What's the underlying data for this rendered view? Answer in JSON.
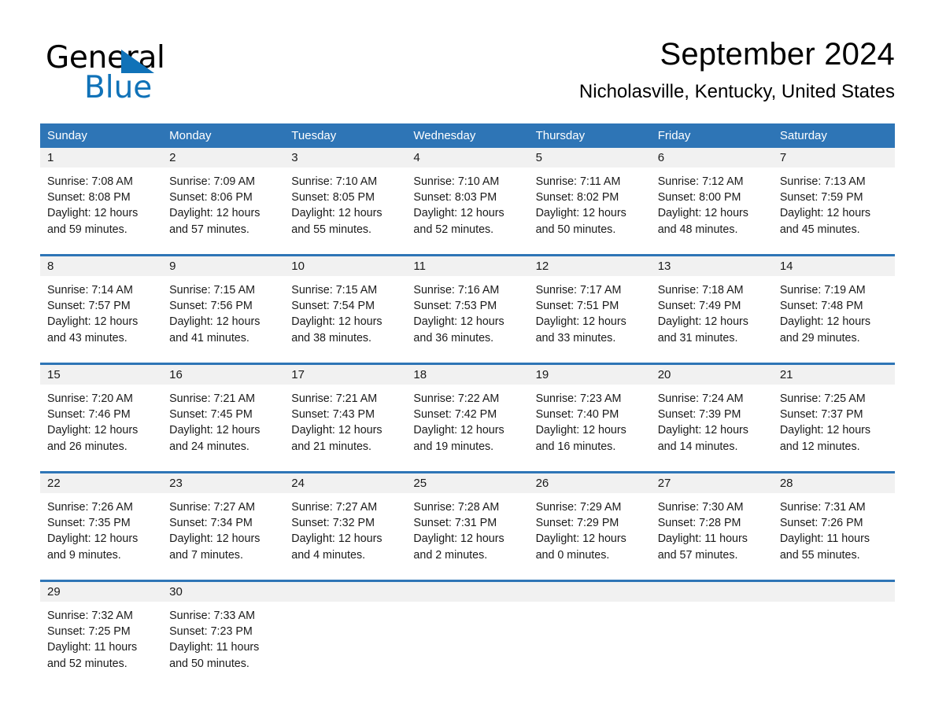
{
  "brand": {
    "logo_text_primary": "General",
    "logo_text_secondary": "Blue",
    "accent_color": "#2e75b6",
    "logo_blue": "#1072b8"
  },
  "header": {
    "title": "September 2024",
    "location": "Nicholasville, Kentucky, United States"
  },
  "calendar": {
    "weekdays": [
      "Sunday",
      "Monday",
      "Tuesday",
      "Wednesday",
      "Thursday",
      "Friday",
      "Saturday"
    ],
    "weeks": [
      {
        "days": [
          {
            "date": "1",
            "sunrise": "Sunrise: 7:08 AM",
            "sunset": "Sunset: 8:08 PM",
            "daylight": "Daylight: 12 hours and 59 minutes."
          },
          {
            "date": "2",
            "sunrise": "Sunrise: 7:09 AM",
            "sunset": "Sunset: 8:06 PM",
            "daylight": "Daylight: 12 hours and 57 minutes."
          },
          {
            "date": "3",
            "sunrise": "Sunrise: 7:10 AM",
            "sunset": "Sunset: 8:05 PM",
            "daylight": "Daylight: 12 hours and 55 minutes."
          },
          {
            "date": "4",
            "sunrise": "Sunrise: 7:10 AM",
            "sunset": "Sunset: 8:03 PM",
            "daylight": "Daylight: 12 hours and 52 minutes."
          },
          {
            "date": "5",
            "sunrise": "Sunrise: 7:11 AM",
            "sunset": "Sunset: 8:02 PM",
            "daylight": "Daylight: 12 hours and 50 minutes."
          },
          {
            "date": "6",
            "sunrise": "Sunrise: 7:12 AM",
            "sunset": "Sunset: 8:00 PM",
            "daylight": "Daylight: 12 hours and 48 minutes."
          },
          {
            "date": "7",
            "sunrise": "Sunrise: 7:13 AM",
            "sunset": "Sunset: 7:59 PM",
            "daylight": "Daylight: 12 hours and 45 minutes."
          }
        ]
      },
      {
        "days": [
          {
            "date": "8",
            "sunrise": "Sunrise: 7:14 AM",
            "sunset": "Sunset: 7:57 PM",
            "daylight": "Daylight: 12 hours and 43 minutes."
          },
          {
            "date": "9",
            "sunrise": "Sunrise: 7:15 AM",
            "sunset": "Sunset: 7:56 PM",
            "daylight": "Daylight: 12 hours and 41 minutes."
          },
          {
            "date": "10",
            "sunrise": "Sunrise: 7:15 AM",
            "sunset": "Sunset: 7:54 PM",
            "daylight": "Daylight: 12 hours and 38 minutes."
          },
          {
            "date": "11",
            "sunrise": "Sunrise: 7:16 AM",
            "sunset": "Sunset: 7:53 PM",
            "daylight": "Daylight: 12 hours and 36 minutes."
          },
          {
            "date": "12",
            "sunrise": "Sunrise: 7:17 AM",
            "sunset": "Sunset: 7:51 PM",
            "daylight": "Daylight: 12 hours and 33 minutes."
          },
          {
            "date": "13",
            "sunrise": "Sunrise: 7:18 AM",
            "sunset": "Sunset: 7:49 PM",
            "daylight": "Daylight: 12 hours and 31 minutes."
          },
          {
            "date": "14",
            "sunrise": "Sunrise: 7:19 AM",
            "sunset": "Sunset: 7:48 PM",
            "daylight": "Daylight: 12 hours and 29 minutes."
          }
        ]
      },
      {
        "days": [
          {
            "date": "15",
            "sunrise": "Sunrise: 7:20 AM",
            "sunset": "Sunset: 7:46 PM",
            "daylight": "Daylight: 12 hours and 26 minutes."
          },
          {
            "date": "16",
            "sunrise": "Sunrise: 7:21 AM",
            "sunset": "Sunset: 7:45 PM",
            "daylight": "Daylight: 12 hours and 24 minutes."
          },
          {
            "date": "17",
            "sunrise": "Sunrise: 7:21 AM",
            "sunset": "Sunset: 7:43 PM",
            "daylight": "Daylight: 12 hours and 21 minutes."
          },
          {
            "date": "18",
            "sunrise": "Sunrise: 7:22 AM",
            "sunset": "Sunset: 7:42 PM",
            "daylight": "Daylight: 12 hours and 19 minutes."
          },
          {
            "date": "19",
            "sunrise": "Sunrise: 7:23 AM",
            "sunset": "Sunset: 7:40 PM",
            "daylight": "Daylight: 12 hours and 16 minutes."
          },
          {
            "date": "20",
            "sunrise": "Sunrise: 7:24 AM",
            "sunset": "Sunset: 7:39 PM",
            "daylight": "Daylight: 12 hours and 14 minutes."
          },
          {
            "date": "21",
            "sunrise": "Sunrise: 7:25 AM",
            "sunset": "Sunset: 7:37 PM",
            "daylight": "Daylight: 12 hours and 12 minutes."
          }
        ]
      },
      {
        "days": [
          {
            "date": "22",
            "sunrise": "Sunrise: 7:26 AM",
            "sunset": "Sunset: 7:35 PM",
            "daylight": "Daylight: 12 hours and 9 minutes."
          },
          {
            "date": "23",
            "sunrise": "Sunrise: 7:27 AM",
            "sunset": "Sunset: 7:34 PM",
            "daylight": "Daylight: 12 hours and 7 minutes."
          },
          {
            "date": "24",
            "sunrise": "Sunrise: 7:27 AM",
            "sunset": "Sunset: 7:32 PM",
            "daylight": "Daylight: 12 hours and 4 minutes."
          },
          {
            "date": "25",
            "sunrise": "Sunrise: 7:28 AM",
            "sunset": "Sunset: 7:31 PM",
            "daylight": "Daylight: 12 hours and 2 minutes."
          },
          {
            "date": "26",
            "sunrise": "Sunrise: 7:29 AM",
            "sunset": "Sunset: 7:29 PM",
            "daylight": "Daylight: 12 hours and 0 minutes."
          },
          {
            "date": "27",
            "sunrise": "Sunrise: 7:30 AM",
            "sunset": "Sunset: 7:28 PM",
            "daylight": "Daylight: 11 hours and 57 minutes."
          },
          {
            "date": "28",
            "sunrise": "Sunrise: 7:31 AM",
            "sunset": "Sunset: 7:26 PM",
            "daylight": "Daylight: 11 hours and 55 minutes."
          }
        ]
      },
      {
        "days": [
          {
            "date": "29",
            "sunrise": "Sunrise: 7:32 AM",
            "sunset": "Sunset: 7:25 PM",
            "daylight": "Daylight: 11 hours and 52 minutes."
          },
          {
            "date": "30",
            "sunrise": "Sunrise: 7:33 AM",
            "sunset": "Sunset: 7:23 PM",
            "daylight": "Daylight: 11 hours and 50 minutes."
          },
          {
            "date": "",
            "sunrise": "",
            "sunset": "",
            "daylight": ""
          },
          {
            "date": "",
            "sunrise": "",
            "sunset": "",
            "daylight": ""
          },
          {
            "date": "",
            "sunrise": "",
            "sunset": "",
            "daylight": ""
          },
          {
            "date": "",
            "sunrise": "",
            "sunset": "",
            "daylight": ""
          },
          {
            "date": "",
            "sunrise": "",
            "sunset": "",
            "daylight": ""
          }
        ]
      }
    ]
  }
}
